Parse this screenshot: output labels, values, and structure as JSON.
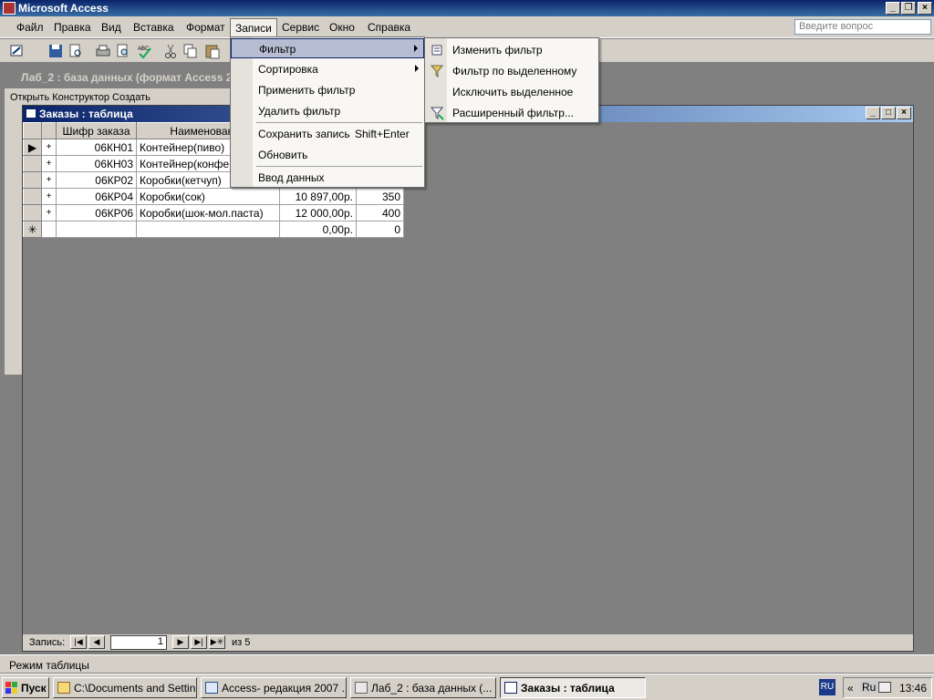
{
  "app": {
    "title": "Microsoft Access"
  },
  "menubar": {
    "items": [
      "Файл",
      "Правка",
      "Вид",
      "Вставка",
      "Формат",
      "Записи",
      "Сервис",
      "Окно",
      "Справка"
    ],
    "ask_placeholder": "Введите вопрос"
  },
  "db_window": {
    "title": "Лаб_2 : база данных (формат Access 2",
    "tools": "Открыть  Конструктор  Создать"
  },
  "table_window": {
    "title": "Заказы : таблица",
    "columns": [
      "Шифр заказа",
      "Наименование",
      "",
      ""
    ],
    "rows": [
      {
        "code": "06КН01",
        "name": "Контейнер(пиво)",
        "sum": "",
        "qty": ""
      },
      {
        "code": "06КН03",
        "name": "Контейнер(конфе",
        "sum": "",
        "qty": ""
      },
      {
        "code": "06КР02",
        "name": "Коробки(кетчуп)",
        "sum": "",
        "qty": ""
      },
      {
        "code": "06КР04",
        "name": "Коробки(сок)",
        "sum": "10 897,00р.",
        "qty": "350"
      },
      {
        "code": "06КР06",
        "name": "Коробки(шок-мол.паста)",
        "sum": "12 000,00р.",
        "qty": "400"
      }
    ],
    "new_row": {
      "sum": "0,00р.",
      "qty": "0"
    },
    "nav": {
      "label": "Запись:",
      "current": "1",
      "of": "из 5"
    }
  },
  "records_menu": {
    "items": [
      {
        "label": "Фильтр",
        "submenu": true
      },
      {
        "label": "Сортировка",
        "submenu": true
      },
      {
        "label": "Применить фильтр"
      },
      {
        "label": "Удалить фильтр"
      },
      {
        "label": "Сохранить запись",
        "shortcut": "Shift+Enter"
      },
      {
        "label": "Обновить"
      },
      {
        "label": "Ввод данных"
      }
    ]
  },
  "filter_submenu": {
    "items": [
      "Изменить фильтр",
      "Фильтр по выделенному",
      "Исключить выделенное",
      "Расширенный фильтр..."
    ]
  },
  "statusbar": {
    "text": "Режим таблицы"
  },
  "taskbar": {
    "start": "Пуск",
    "tasks": [
      "C:\\Documents and Settin...",
      "Access- редакция 2007 ...",
      "Лаб_2 : база данных (...",
      "Заказы : таблица"
    ],
    "tray": {
      "lang": "RU",
      "lang2": "Ru",
      "time": "13:46"
    }
  }
}
